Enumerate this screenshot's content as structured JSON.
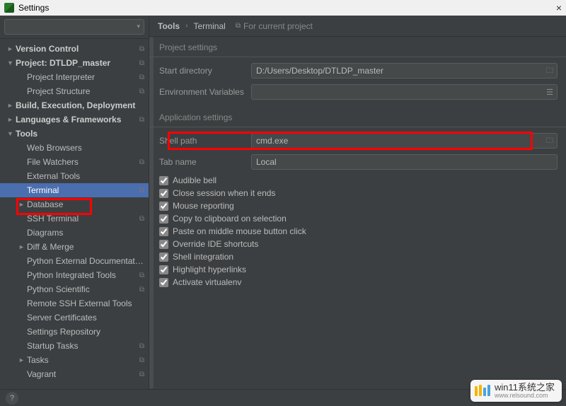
{
  "window": {
    "title": "Settings"
  },
  "search": {
    "placeholder": ""
  },
  "sidebar": {
    "items": [
      {
        "label": "Version Control",
        "bold": true,
        "chev": "►",
        "badge": "⧉",
        "indent": 0
      },
      {
        "label": "Project: DTLDP_master",
        "bold": true,
        "chev": "▼",
        "badge": "⧉",
        "indent": 0
      },
      {
        "label": "Project Interpreter",
        "bold": false,
        "chev": "",
        "badge": "⧉",
        "indent": 1
      },
      {
        "label": "Project Structure",
        "bold": false,
        "chev": "",
        "badge": "⧉",
        "indent": 1
      },
      {
        "label": "Build, Execution, Deployment",
        "bold": true,
        "chev": "►",
        "badge": "",
        "indent": 0
      },
      {
        "label": "Languages & Frameworks",
        "bold": true,
        "chev": "►",
        "badge": "⧉",
        "indent": 0
      },
      {
        "label": "Tools",
        "bold": true,
        "chev": "▼",
        "badge": "",
        "indent": 0
      },
      {
        "label": "Web Browsers",
        "bold": false,
        "chev": "",
        "badge": "",
        "indent": 1
      },
      {
        "label": "File Watchers",
        "bold": false,
        "chev": "",
        "badge": "⧉",
        "indent": 1
      },
      {
        "label": "External Tools",
        "bold": false,
        "chev": "",
        "badge": "",
        "indent": 1
      },
      {
        "label": "Terminal",
        "bold": false,
        "chev": "",
        "badge": "⧉",
        "indent": 1,
        "selected": true
      },
      {
        "label": "Database",
        "bold": false,
        "chev": "►",
        "badge": "",
        "indent": 1
      },
      {
        "label": "SSH Terminal",
        "bold": false,
        "chev": "",
        "badge": "⧉",
        "indent": 1
      },
      {
        "label": "Diagrams",
        "bold": false,
        "chev": "",
        "badge": "",
        "indent": 1
      },
      {
        "label": "Diff & Merge",
        "bold": false,
        "chev": "►",
        "badge": "",
        "indent": 1
      },
      {
        "label": "Python External Documentation",
        "bold": false,
        "chev": "",
        "badge": "",
        "indent": 1
      },
      {
        "label": "Python Integrated Tools",
        "bold": false,
        "chev": "",
        "badge": "⧉",
        "indent": 1
      },
      {
        "label": "Python Scientific",
        "bold": false,
        "chev": "",
        "badge": "⧉",
        "indent": 1
      },
      {
        "label": "Remote SSH External Tools",
        "bold": false,
        "chev": "",
        "badge": "",
        "indent": 1
      },
      {
        "label": "Server Certificates",
        "bold": false,
        "chev": "",
        "badge": "",
        "indent": 1
      },
      {
        "label": "Settings Repository",
        "bold": false,
        "chev": "",
        "badge": "",
        "indent": 1
      },
      {
        "label": "Startup Tasks",
        "bold": false,
        "chev": "",
        "badge": "⧉",
        "indent": 1
      },
      {
        "label": "Tasks",
        "bold": false,
        "chev": "►",
        "badge": "⧉",
        "indent": 1
      },
      {
        "label": "Vagrant",
        "bold": false,
        "chev": "",
        "badge": "⧉",
        "indent": 1
      }
    ]
  },
  "breadcrumb": {
    "root": "Tools",
    "leaf": "Terminal",
    "scope": "For current project"
  },
  "sections": {
    "project": {
      "title": "Project settings",
      "start_dir_label": "Start directory",
      "start_dir_value": "D:/Users/Desktop/DTLDP_master",
      "env_label": "Environment Variables",
      "env_value": ""
    },
    "app": {
      "title": "Application settings",
      "shell_label": "Shell path",
      "shell_value": "cmd.exe",
      "tab_label": "Tab name",
      "tab_value": "Local",
      "checks": [
        "Audible bell",
        "Close session when it ends",
        "Mouse reporting",
        "Copy to clipboard on selection",
        "Paste on middle mouse button click",
        "Override IDE shortcuts",
        "Shell integration",
        "Highlight hyperlinks",
        "Activate virtualenv"
      ]
    }
  },
  "help": {
    "label": "?"
  },
  "watermark": {
    "main": "win11系统之家",
    "sub": "www.relsound.com"
  }
}
